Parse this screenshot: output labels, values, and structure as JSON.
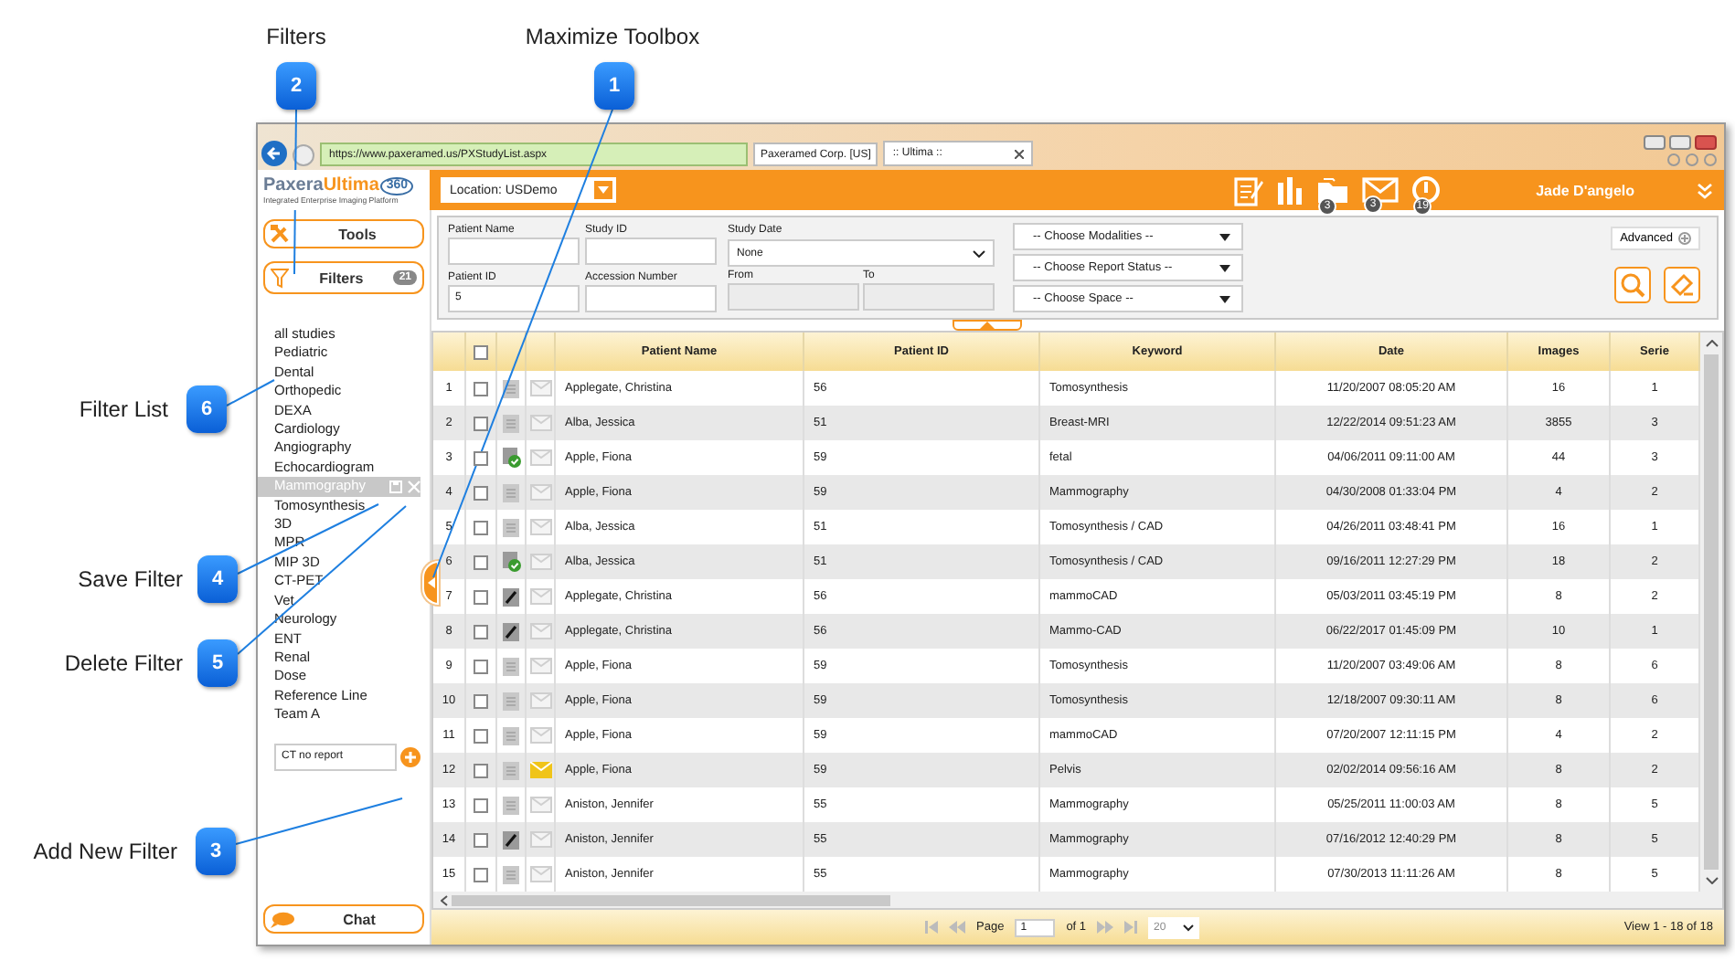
{
  "callouts": [
    {
      "number": "2",
      "label": "Filters"
    },
    {
      "number": "1",
      "label": "Maximize Toolbox"
    },
    {
      "number": "6",
      "label": "Filter List"
    },
    {
      "number": "4",
      "label": "Save Filter"
    },
    {
      "number": "5",
      "label": "Delete Filter"
    },
    {
      "number": "3",
      "label": "Add New Filter"
    }
  ],
  "browser": {
    "url": "https://www.paxeramed.us/PXStudyList.aspx",
    "site": "Paxeramed Corp. [US]",
    "tab": ":: Ultima ::"
  },
  "header": {
    "logo_primary": "Paxera",
    "logo_secondary": "Ultima",
    "logo_version": "360",
    "tagline": "Integrated Enterprise Imaging Platform",
    "location": "Location: USDemo",
    "icons": [
      {
        "kind": "report"
      },
      {
        "kind": "chart"
      },
      {
        "kind": "folder",
        "badge": "3"
      },
      {
        "kind": "mail",
        "badge": "3"
      },
      {
        "kind": "alert",
        "badge": "19"
      }
    ],
    "user": "Jade D'angelo"
  },
  "sidebar": {
    "tools": "Tools",
    "filters": {
      "label": "Filters",
      "count": "21"
    },
    "filter_items": [
      {
        "label": "all studies",
        "selected": false
      },
      {
        "label": "Pediatric",
        "selected": false
      },
      {
        "label": "Dental",
        "selected": false
      },
      {
        "label": "Orthopedic",
        "selected": false
      },
      {
        "label": "DEXA",
        "selected": false
      },
      {
        "label": "Cardiology",
        "selected": false
      },
      {
        "label": "Angiography",
        "selected": false
      },
      {
        "label": "Echocardiogram",
        "selected": false
      },
      {
        "label": "Mammography",
        "selected": true
      },
      {
        "label": "Tomosynthesis",
        "selected": false
      },
      {
        "label": "3D",
        "selected": false
      },
      {
        "label": "MPR",
        "selected": false
      },
      {
        "label": "MIP 3D",
        "selected": false
      },
      {
        "label": "CT-PET",
        "selected": false
      },
      {
        "label": "Vet",
        "selected": false
      },
      {
        "label": "Neurology",
        "selected": false
      },
      {
        "label": "ENT",
        "selected": false
      },
      {
        "label": "Renal",
        "selected": false
      },
      {
        "label": "Dose",
        "selected": false
      },
      {
        "label": "Reference Line",
        "selected": false
      },
      {
        "label": "Team A",
        "selected": false
      }
    ],
    "new_filter": {
      "value": "CT no report"
    },
    "chat": "Chat"
  },
  "search": {
    "fields": [
      {
        "label": "Patient Name"
      },
      {
        "label": "Study ID"
      },
      {
        "label": "Patient ID",
        "value": "5"
      },
      {
        "label": "Accession Number"
      }
    ],
    "study_date": {
      "label": "Study Date",
      "value": "None"
    },
    "range": [
      {
        "label": "From",
        "disabled": true
      },
      {
        "label": "To",
        "disabled": true
      }
    ],
    "dropdowns": [
      "-- Choose Modalities --",
      "-- Choose Report Status --",
      "-- Choose Space --"
    ],
    "advanced": "Advanced"
  },
  "table": {
    "select_all": {
      "checked": false
    },
    "columns": [
      "Patient Name",
      "Patient ID",
      "Keyword",
      "Date",
      "Images",
      "Serie"
    ],
    "rows": [
      {
        "number": "1",
        "checked": false,
        "report": {
          "kind": "doc"
        },
        "message": {
          "kind": "read"
        },
        "cells": [
          "Applegate, Christina",
          "56",
          "Tomosynthesis",
          "11/20/2007 08:05:20 AM",
          "16",
          "1"
        ]
      },
      {
        "number": "2",
        "checked": false,
        "report": {
          "kind": "doc"
        },
        "message": {
          "kind": "read"
        },
        "cells": [
          "Alba, Jessica",
          "51",
          "Breast-MRI",
          "12/22/2014 09:51:23 AM",
          "3855",
          "3"
        ]
      },
      {
        "number": "3",
        "checked": false,
        "report": {
          "kind": "verified"
        },
        "message": {
          "kind": "read"
        },
        "cells": [
          "Apple, Fiona",
          "59",
          "fetal",
          "04/06/2011 09:11:00 AM",
          "44",
          "3"
        ]
      },
      {
        "number": "4",
        "checked": false,
        "report": {
          "kind": "doc"
        },
        "message": {
          "kind": "read"
        },
        "cells": [
          "Apple, Fiona",
          "59",
          "Mammography",
          "04/30/2008 01:33:04 PM",
          "4",
          "2"
        ]
      },
      {
        "number": "5",
        "checked": false,
        "report": {
          "kind": "doc"
        },
        "message": {
          "kind": "read"
        },
        "cells": [
          "Alba, Jessica",
          "51",
          "Tomosynthesis / CAD",
          "04/26/2011 03:48:41 PM",
          "16",
          "1"
        ]
      },
      {
        "number": "6",
        "checked": false,
        "report": {
          "kind": "verified"
        },
        "message": {
          "kind": "read"
        },
        "cells": [
          "Alba, Jessica",
          "51",
          "Tomosynthesis / CAD",
          "09/16/2011 12:27:29 PM",
          "18",
          "2"
        ]
      },
      {
        "number": "7",
        "checked": false,
        "report": {
          "kind": "edit"
        },
        "message": {
          "kind": "read"
        },
        "cells": [
          "Applegate, Christina",
          "56",
          "mammoCAD",
          "05/03/2011 03:45:19 PM",
          "8",
          "2"
        ]
      },
      {
        "number": "8",
        "checked": false,
        "report": {
          "kind": "edit"
        },
        "message": {
          "kind": "read"
        },
        "cells": [
          "Applegate, Christina",
          "56",
          "Mammo-CAD",
          "06/22/2017 01:45:09 PM",
          "10",
          "1"
        ]
      },
      {
        "number": "9",
        "checked": false,
        "report": {
          "kind": "doc"
        },
        "message": {
          "kind": "read"
        },
        "cells": [
          "Apple, Fiona",
          "59",
          "Tomosynthesis",
          "11/20/2007 03:49:06 AM",
          "8",
          "6"
        ]
      },
      {
        "number": "10",
        "checked": false,
        "report": {
          "kind": "doc"
        },
        "message": {
          "kind": "read"
        },
        "cells": [
          "Apple, Fiona",
          "59",
          "Tomosynthesis",
          "12/18/2007 09:30:11 AM",
          "8",
          "6"
        ]
      },
      {
        "number": "11",
        "checked": false,
        "report": {
          "kind": "doc"
        },
        "message": {
          "kind": "read"
        },
        "cells": [
          "Apple, Fiona",
          "59",
          "mammoCAD",
          "07/20/2007 12:11:15 PM",
          "4",
          "2"
        ]
      },
      {
        "number": "12",
        "checked": false,
        "report": {
          "kind": "doc"
        },
        "message": {
          "kind": "unread"
        },
        "cells": [
          "Apple, Fiona",
          "59",
          "Pelvis",
          "02/02/2014 09:56:16 AM",
          "8",
          "2"
        ]
      },
      {
        "number": "13",
        "checked": false,
        "report": {
          "kind": "doc"
        },
        "message": {
          "kind": "read"
        },
        "cells": [
          "Aniston, Jennifer",
          "55",
          "Mammography",
          "05/25/2011 11:00:03 AM",
          "8",
          "5"
        ]
      },
      {
        "number": "14",
        "checked": false,
        "report": {
          "kind": "edit"
        },
        "message": {
          "kind": "read"
        },
        "cells": [
          "Aniston, Jennifer",
          "55",
          "Mammography",
          "07/16/2012 12:40:29 PM",
          "8",
          "5"
        ]
      },
      {
        "number": "15",
        "checked": false,
        "report": {
          "kind": "doc"
        },
        "message": {
          "kind": "read"
        },
        "cells": [
          "Aniston, Jennifer",
          "55",
          "Mammography",
          "07/30/2013 11:11:26 AM",
          "8",
          "5"
        ]
      }
    ]
  },
  "pager": {
    "page_label": "Page",
    "page": "1",
    "of": "of 1",
    "page_size": "20",
    "summary": "View 1 - 18 of 18"
  }
}
